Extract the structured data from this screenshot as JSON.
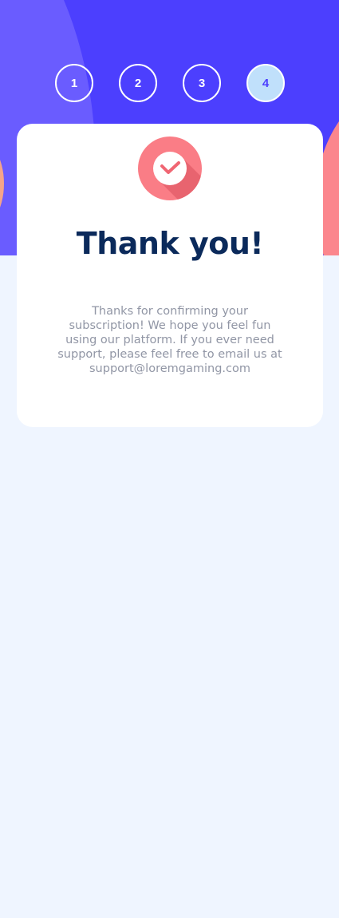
{
  "steps": [
    {
      "label": "1",
      "active": false
    },
    {
      "label": "2",
      "active": false
    },
    {
      "label": "3",
      "active": false
    },
    {
      "label": "4",
      "active": true
    }
  ],
  "card": {
    "icon": "check-circle-icon",
    "title": "Thank you!",
    "message": "Thanks for confirming your subscription! We hope you feel fun using our platform. If you ever need support, please feel free to email us at support@loremgaming.com"
  },
  "colors": {
    "hero_background": "#4c3ffe",
    "page_background": "#eff5ff",
    "accent_coral": "#fb868d",
    "title": "#0b2a5b",
    "body_text": "#9196a5",
    "active_step": "#c0e0fb"
  }
}
